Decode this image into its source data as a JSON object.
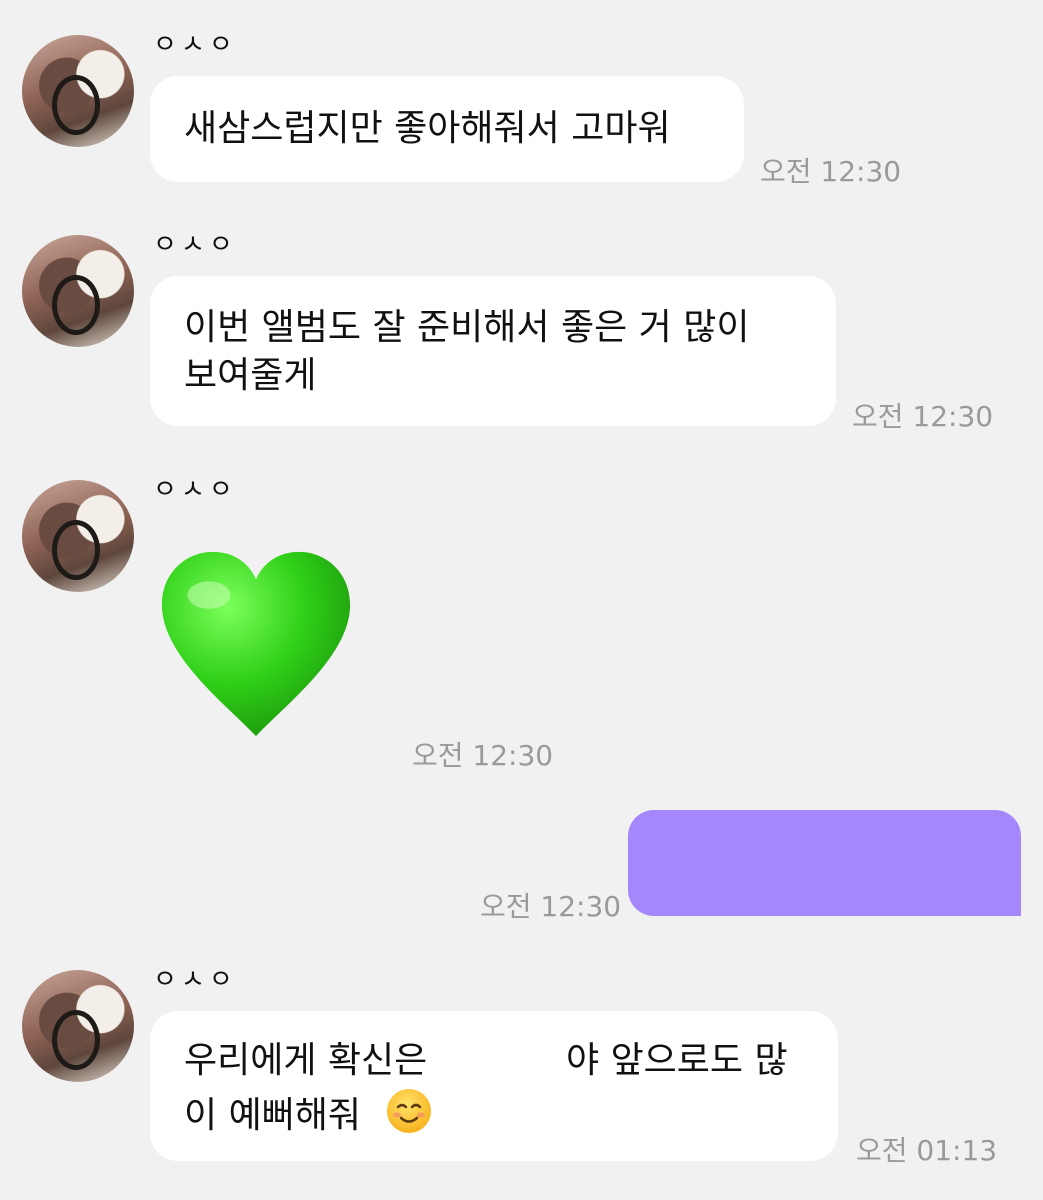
{
  "messages": [
    {
      "sender": "ㅇㅅㅇ",
      "text": "새삼스럽지만 좋아해줘서 고마워",
      "time": "오전 12:30"
    },
    {
      "sender": "ㅇㅅㅇ",
      "line1": "이번 앨범도 잘 준비해서 좋은 거 많이",
      "line2": "보여줄게",
      "time": "오전 12:30"
    },
    {
      "sender": "ㅇㅅㅇ",
      "emoji": "green-heart-emoji",
      "time": "오전 12:30"
    },
    {
      "outgoing": true,
      "text": "",
      "time": "오전 12:30"
    },
    {
      "sender": "ㅇㅅㅇ",
      "line1_a": "우리에게 확신은",
      "line1_b": "야 앞으로도 많",
      "line2": "이 예뻐해줘",
      "emoji": "smiling-face-emoji",
      "time": "오전 01:13"
    }
  ],
  "colors": {
    "background": "#f1f1f1",
    "incoming_bubble": "#ffffff",
    "outgoing_bubble": "#a488fb",
    "timestamp": "#9a9a9a",
    "heart": "#2ecc1a"
  }
}
